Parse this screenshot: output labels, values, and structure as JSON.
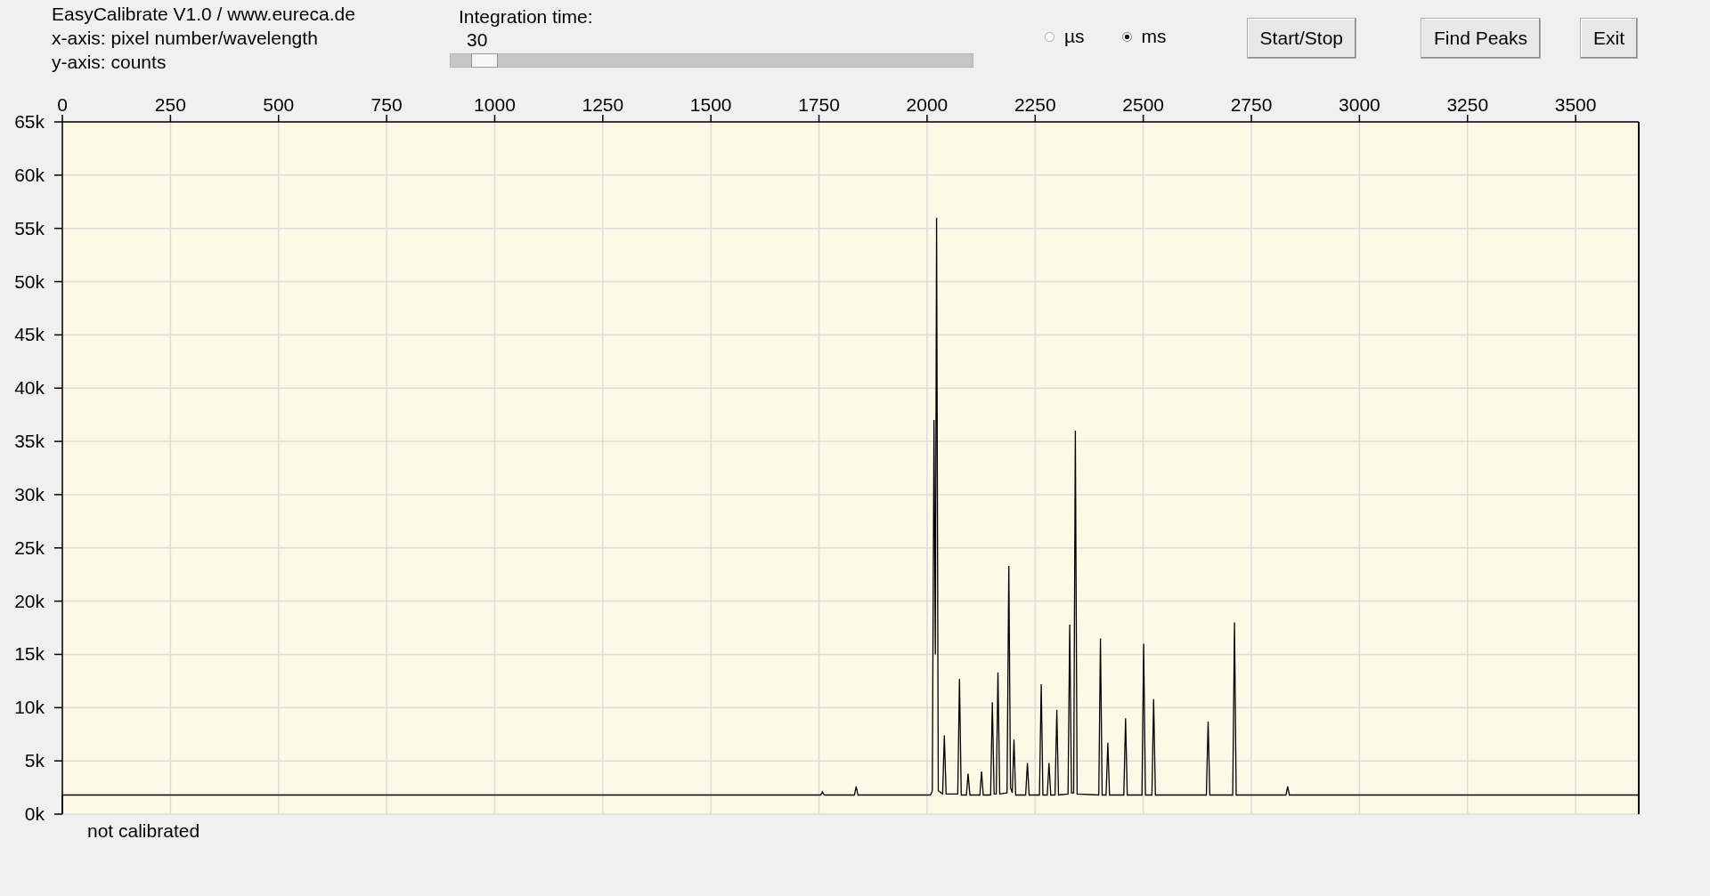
{
  "info_lines": [
    "EasyCalibrate V1.0 / www.eureca.de",
    "x-axis: pixel number/wavelength",
    "y-axis: counts"
  ],
  "integration": {
    "label": "Integration time:",
    "value": "30",
    "level": 0.04
  },
  "units": [
    {
      "label": "µs",
      "selected": false
    },
    {
      "label": "ms",
      "selected": true
    }
  ],
  "buttons": [
    "Start/Stop",
    "Find Peaks",
    "Exit"
  ],
  "chart": {
    "chart_data": {
      "type": "line",
      "grid": true,
      "xlim": [
        0,
        3646
      ],
      "ylim": [
        0,
        65000
      ],
      "xticks": [
        0,
        250,
        500,
        750,
        1000,
        1250,
        1500,
        1750,
        2000,
        2250,
        2500,
        2750,
        3000,
        3250,
        3500
      ],
      "yticks": [
        {
          "value": 0,
          "label": "0k"
        },
        {
          "value": 5000,
          "label": "5k"
        },
        {
          "value": 10000,
          "label": "10k"
        },
        {
          "value": 15000,
          "label": "15k"
        },
        {
          "value": 20000,
          "label": "20k"
        },
        {
          "value": 25000,
          "label": "25k"
        },
        {
          "value": 30000,
          "label": "30k"
        },
        {
          "value": 35000,
          "label": "35k"
        },
        {
          "value": 40000,
          "label": "40k"
        },
        {
          "value": 45000,
          "label": "45k"
        },
        {
          "value": 50000,
          "label": "50k"
        },
        {
          "value": 55000,
          "label": "55k"
        },
        {
          "value": 60000,
          "label": "60k"
        },
        {
          "value": 65000,
          "label": "65k"
        }
      ],
      "x": [
        0,
        0,
        1754,
        1758,
        1762,
        1832,
        1836,
        1840,
        2008,
        2012,
        2016,
        2019,
        2022,
        2026,
        2036,
        2040,
        2044,
        2071,
        2075,
        2079,
        2091,
        2095,
        2099,
        2122,
        2126,
        2130,
        2147,
        2151,
        2155,
        2160,
        2164,
        2168,
        2185,
        2189,
        2193,
        2197,
        2201,
        2205,
        2228,
        2232,
        2236,
        2260,
        2264,
        2268,
        2278,
        2282,
        2286,
        2296,
        2300,
        2304,
        2326,
        2330,
        2334,
        2339,
        2343,
        2347,
        2397,
        2401,
        2405,
        2414,
        2418,
        2422,
        2455,
        2459,
        2463,
        2497,
        2501,
        2505,
        2520,
        2524,
        2528,
        2646,
        2650,
        2654,
        2707,
        2711,
        2715,
        2830,
        2834,
        2838,
        3646
      ],
      "series": [
        {
          "color": "#000000",
          "values": [
            0,
            1800,
            1800,
            2100,
            1800,
            1800,
            2600,
            1800,
            1800,
            2200,
            37000,
            15000,
            56000,
            2200,
            1900,
            7400,
            1900,
            1900,
            12700,
            1800,
            1800,
            3800,
            1800,
            1800,
            4000,
            1800,
            1800,
            10500,
            1900,
            1900,
            13300,
            1900,
            2000,
            23300,
            2500,
            2000,
            7000,
            1800,
            1800,
            4800,
            1800,
            1800,
            12200,
            1800,
            1800,
            4800,
            1800,
            1800,
            9800,
            1800,
            1900,
            17800,
            2000,
            2000,
            36000,
            1900,
            1800,
            16500,
            1800,
            1800,
            6700,
            1800,
            1800,
            9000,
            1800,
            1800,
            16000,
            1800,
            1800,
            10800,
            1800,
            1800,
            8700,
            1800,
            1800,
            18000,
            1800,
            1800,
            2600,
            1800,
            1800
          ]
        }
      ]
    }
  },
  "status": "not calibrated"
}
